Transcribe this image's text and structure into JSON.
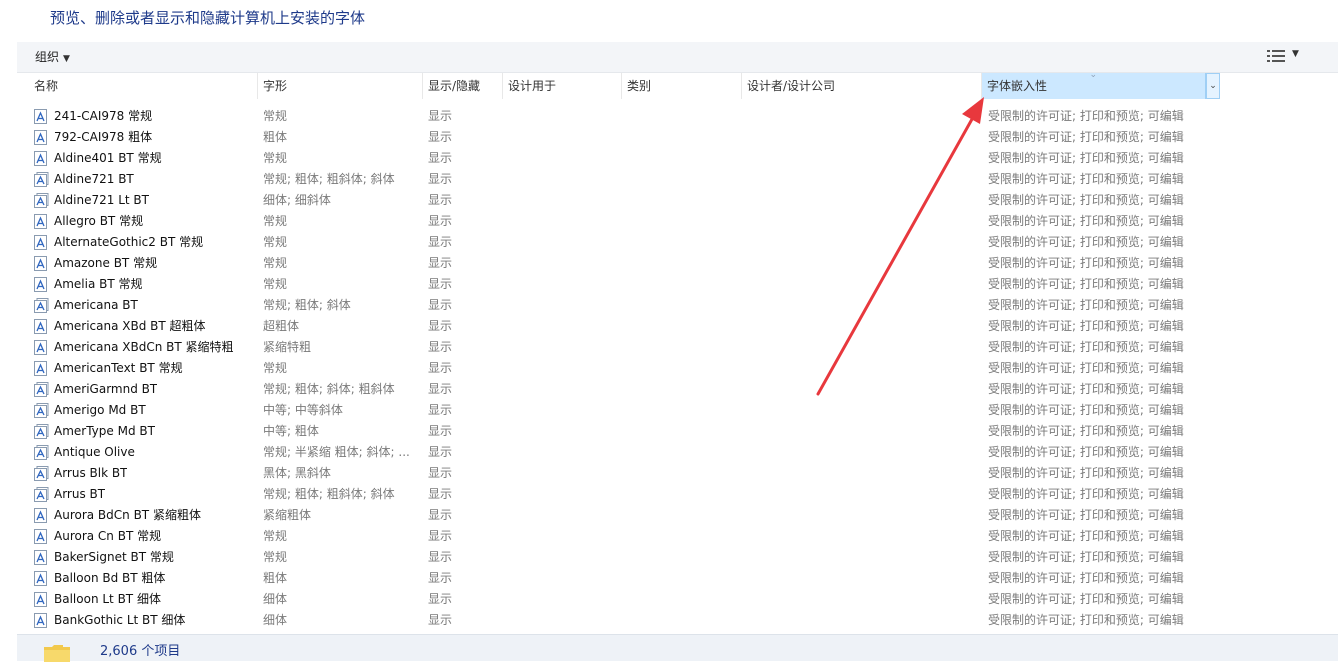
{
  "page_title": "预览、删除或者显示和隐藏计算机上安装的字体",
  "toolbar": {
    "organize_label": "组织",
    "organize_caret": "▼",
    "view_caret": "▼",
    "view_icon": "details-view-icon",
    "help_icon": "help-icon"
  },
  "columns": {
    "name": "名称",
    "style": "字形",
    "show_hide": "显示/隐藏",
    "designed_for": "设计用于",
    "category": "类别",
    "designer": "设计者/设计公司",
    "embeddability": "字体嵌入性"
  },
  "sort_indicator": "⌄",
  "dropdown_glyph": "⌄",
  "rows": [
    {
      "name": "241-CAI978 常规",
      "style": "常规",
      "show": "显示",
      "embed": "受限制的许可证; 打印和预览; 可编辑",
      "icon": "font-file-icon"
    },
    {
      "name": "792-CAI978 粗体",
      "style": "粗体",
      "show": "显示",
      "embed": "受限制的许可证; 打印和预览; 可编辑",
      "icon": "font-file-icon"
    },
    {
      "name": "Aldine401 BT 常规",
      "style": "常规",
      "show": "显示",
      "embed": "受限制的许可证; 打印和预览; 可编辑",
      "icon": "font-file-icon"
    },
    {
      "name": "Aldine721 BT",
      "style": "常规; 粗体; 粗斜体; 斜体",
      "show": "显示",
      "embed": "受限制的许可证; 打印和预览; 可编辑",
      "icon": "font-family-icon"
    },
    {
      "name": "Aldine721 Lt BT",
      "style": "细体; 细斜体",
      "show": "显示",
      "embed": "受限制的许可证; 打印和预览; 可编辑",
      "icon": "font-family-icon"
    },
    {
      "name": "Allegro BT 常规",
      "style": "常规",
      "show": "显示",
      "embed": "受限制的许可证; 打印和预览; 可编辑",
      "icon": "font-file-icon"
    },
    {
      "name": "AlternateGothic2 BT 常规",
      "style": "常规",
      "show": "显示",
      "embed": "受限制的许可证; 打印和预览; 可编辑",
      "icon": "font-file-icon"
    },
    {
      "name": "Amazone BT 常规",
      "style": "常规",
      "show": "显示",
      "embed": "受限制的许可证; 打印和预览; 可编辑",
      "icon": "font-file-icon"
    },
    {
      "name": "Amelia BT 常规",
      "style": "常规",
      "show": "显示",
      "embed": "受限制的许可证; 打印和预览; 可编辑",
      "icon": "font-file-icon"
    },
    {
      "name": "Americana BT",
      "style": "常规; 粗体; 斜体",
      "show": "显示",
      "embed": "受限制的许可证; 打印和预览; 可编辑",
      "icon": "font-family-icon"
    },
    {
      "name": "Americana XBd BT 超粗体",
      "style": "超粗体",
      "show": "显示",
      "embed": "受限制的许可证; 打印和预览; 可编辑",
      "icon": "font-file-icon"
    },
    {
      "name": "Americana XBdCn BT 紧缩特粗",
      "style": "紧缩特粗",
      "show": "显示",
      "embed": "受限制的许可证; 打印和预览; 可编辑",
      "icon": "font-file-icon"
    },
    {
      "name": "AmericanText BT 常规",
      "style": "常规",
      "show": "显示",
      "embed": "受限制的许可证; 打印和预览; 可编辑",
      "icon": "font-file-icon"
    },
    {
      "name": "AmeriGarmnd BT",
      "style": "常规; 粗体; 斜体; 粗斜体",
      "show": "显示",
      "embed": "受限制的许可证; 打印和预览; 可编辑",
      "icon": "font-family-icon"
    },
    {
      "name": "Amerigo Md BT",
      "style": "中等; 中等斜体",
      "show": "显示",
      "embed": "受限制的许可证; 打印和预览; 可编辑",
      "icon": "font-family-icon"
    },
    {
      "name": "AmerType Md BT",
      "style": "中等; 粗体",
      "show": "显示",
      "embed": "受限制的许可证; 打印和预览; 可编辑",
      "icon": "font-family-icon"
    },
    {
      "name": "Antique Olive",
      "style": "常规; 半紧缩 粗体; 斜体; ...",
      "show": "显示",
      "embed": "受限制的许可证; 打印和预览; 可编辑",
      "icon": "font-family-icon"
    },
    {
      "name": "Arrus Blk BT",
      "style": "黑体; 黑斜体",
      "show": "显示",
      "embed": "受限制的许可证; 打印和预览; 可编辑",
      "icon": "font-family-icon"
    },
    {
      "name": "Arrus BT",
      "style": "常规; 粗体; 粗斜体; 斜体",
      "show": "显示",
      "embed": "受限制的许可证; 打印和预览; 可编辑",
      "icon": "font-family-icon"
    },
    {
      "name": "Aurora BdCn BT 紧缩粗体",
      "style": "紧缩粗体",
      "show": "显示",
      "embed": "受限制的许可证; 打印和预览; 可编辑",
      "icon": "font-file-icon"
    },
    {
      "name": "Aurora Cn BT 常规",
      "style": "常规",
      "show": "显示",
      "embed": "受限制的许可证; 打印和预览; 可编辑",
      "icon": "font-file-icon"
    },
    {
      "name": "BakerSignet BT 常规",
      "style": "常规",
      "show": "显示",
      "embed": "受限制的许可证; 打印和预览; 可编辑",
      "icon": "font-file-icon"
    },
    {
      "name": "Balloon Bd BT 粗体",
      "style": "粗体",
      "show": "显示",
      "embed": "受限制的许可证; 打印和预览; 可编辑",
      "icon": "font-file-icon"
    },
    {
      "name": "Balloon Lt BT 细体",
      "style": "细体",
      "show": "显示",
      "embed": "受限制的许可证; 打印和预览; 可编辑",
      "icon": "font-file-icon"
    },
    {
      "name": "BankGothic Lt BT 细体",
      "style": "细体",
      "show": "显示",
      "embed": "受限制的许可证; 打印和预览; 可编辑",
      "icon": "font-file-icon"
    }
  ],
  "status": {
    "item_count": "2,606 个项目",
    "folder_icon": "folder-icon"
  },
  "annotation": {
    "arrow_color": "#e8383d",
    "icon": "red-arrow-annotation"
  },
  "colors": {
    "title": "#1e3a8a",
    "active_column": "#cce8ff",
    "muted_text": "#7a7a7a"
  }
}
